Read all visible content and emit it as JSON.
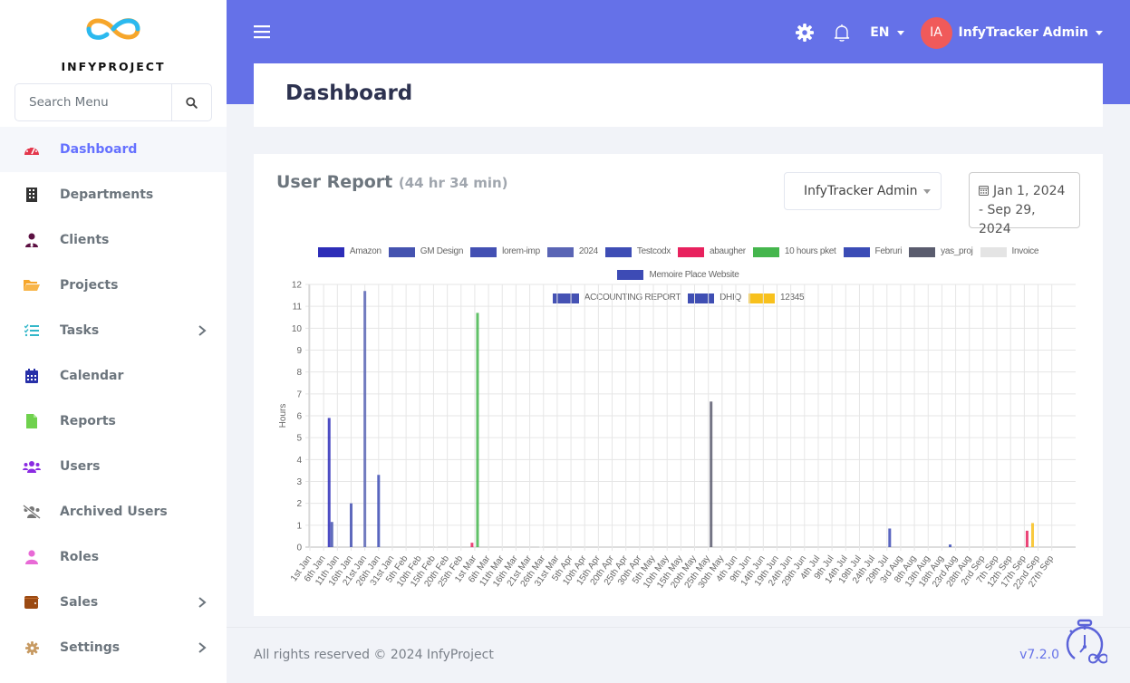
{
  "app": {
    "brand": "INFYPROJECT"
  },
  "sidebar": {
    "search_placeholder": "Search Menu",
    "items": [
      {
        "label": "Dashboard",
        "icon": "tachometer-icon",
        "color": "#e3364b",
        "active": true
      },
      {
        "label": "Departments",
        "icon": "building-icon",
        "color": "#333333"
      },
      {
        "label": "Clients",
        "icon": "user-tie-icon",
        "color": "#5c1042"
      },
      {
        "label": "Projects",
        "icon": "folder-open-icon",
        "color": "#f6a62b"
      },
      {
        "label": "Tasks",
        "icon": "tasks-icon",
        "color": "#33b7c9",
        "has_submenu": true
      },
      {
        "label": "Calendar",
        "icon": "calendar-icon",
        "color": "#2730a8"
      },
      {
        "label": "Reports",
        "icon": "file-icon",
        "color": "#6fd14d"
      },
      {
        "label": "Users",
        "icon": "users-icon",
        "color": "#8b2be2"
      },
      {
        "label": "Archived Users",
        "icon": "users-slash-icon",
        "color": "#777777"
      },
      {
        "label": "Roles",
        "icon": "user-icon",
        "color": "#e86ad6"
      },
      {
        "label": "Sales",
        "icon": "wallet-icon",
        "color": "#9b4a12",
        "has_submenu": true
      },
      {
        "label": "Settings",
        "icon": "cog-icon",
        "color": "#c79a62",
        "has_submenu": true
      }
    ]
  },
  "header": {
    "language": "EN",
    "user_initials": "IA",
    "user_name": "InfyTracker Admin"
  },
  "page": {
    "title": "Dashboard"
  },
  "report": {
    "title": "User Report",
    "total": "(44 hr 34 min)",
    "user_select": "InfyTracker Admin",
    "date_from": "Jan 1, 2024",
    "date_to": "- Sep 29, 2024"
  },
  "chart_data": {
    "type": "bar",
    "title": "",
    "xlabel": "",
    "ylabel": "Hours",
    "ylim": [
      0,
      12
    ],
    "yticks": [
      0,
      1,
      2,
      3,
      4,
      5,
      6,
      7,
      8,
      9,
      10,
      11,
      12
    ],
    "grid": true,
    "legend_position": "top",
    "x_start": "2024-01-01",
    "x_end": "2024-09-29",
    "x_tick_labels": [
      "1st Jan",
      "6th Jan",
      "11th Jan",
      "16th Jan",
      "21st Jan",
      "26th Jan",
      "31st Jan",
      "5th Feb",
      "10th Feb",
      "15th Feb",
      "20th Feb",
      "25th Feb",
      "1st Mar",
      "6th Mar",
      "11th Mar",
      "16th Mar",
      "21st Mar",
      "26th Mar",
      "31st Mar",
      "5th Apr",
      "10th Apr",
      "15th Apr",
      "20th Apr",
      "25th Apr",
      "30th Apr",
      "5th May",
      "10th May",
      "15th May",
      "20th May",
      "25th May",
      "30th May",
      "4th Jun",
      "9th Jun",
      "14th Jun",
      "19th Jun",
      "24th Jun",
      "29th Jun",
      "4th Jul",
      "9th Jul",
      "14th Jul",
      "19th Jul",
      "24th Jul",
      "29th Jul",
      "3rd Aug",
      "8th Aug",
      "13th Aug",
      "18th Aug",
      "23rd Aug",
      "28th Aug",
      "2nd Sep",
      "7th Sep",
      "12th Sep",
      "17th Sep",
      "22nd Sep",
      "27th Sep"
    ],
    "series": [
      {
        "name": "Amazon",
        "color": "#2d2db8",
        "points": [
          {
            "day": 7,
            "value": 5.9
          }
        ]
      },
      {
        "name": "GM Design",
        "color": "#4553b0",
        "points": [
          {
            "day": 8,
            "value": 1.15
          }
        ]
      },
      {
        "name": "lorem-imp",
        "color": "#4350b3",
        "points": [
          {
            "day": 15,
            "value": 2.0
          }
        ]
      },
      {
        "name": "2024",
        "color": "#5a65b5",
        "points": [
          {
            "day": 20,
            "value": 11.7
          }
        ]
      },
      {
        "name": "Testcodx",
        "color": "#3e4db5",
        "points": [
          {
            "day": 25,
            "value": 3.3
          }
        ]
      },
      {
        "name": "abaugher",
        "color": "#e8225e",
        "points": [
          {
            "day": 59,
            "value": 0.2
          },
          {
            "day": 261,
            "value": 0.75
          }
        ]
      },
      {
        "name": "10 hours pket",
        "color": "#45b64d",
        "points": [
          {
            "day": 61,
            "value": 10.7
          }
        ]
      },
      {
        "name": "Februri",
        "color": "#3b4cb6",
        "points": [
          {
            "day": 233,
            "value": 0.12
          }
        ]
      },
      {
        "name": "yas_proj",
        "color": "#5a5c6e",
        "points": [
          {
            "day": 146,
            "value": 6.65
          }
        ]
      },
      {
        "name": "Invoice",
        "color": "#e4e4e4",
        "points": [
          {
            "day": 46,
            "value": 0.03
          },
          {
            "day": 84,
            "value": 0.02
          }
        ]
      },
      {
        "name": "Memoire Place Website",
        "color": "#3d4bb5",
        "points": [
          {
            "day": 211,
            "value": 0.85
          }
        ]
      },
      {
        "name": "ACCOUNTING REPORT",
        "color": "#4552b4",
        "points": []
      },
      {
        "name": "DHIQ",
        "color": "#3f4eb3",
        "points": []
      },
      {
        "name": "12345",
        "color": "#f8c11d",
        "points": [
          {
            "day": 263,
            "value": 1.1
          }
        ]
      }
    ]
  },
  "footer": {
    "copyright": "All rights reserved © 2024 InfyProject",
    "version": "v7.2.0"
  }
}
